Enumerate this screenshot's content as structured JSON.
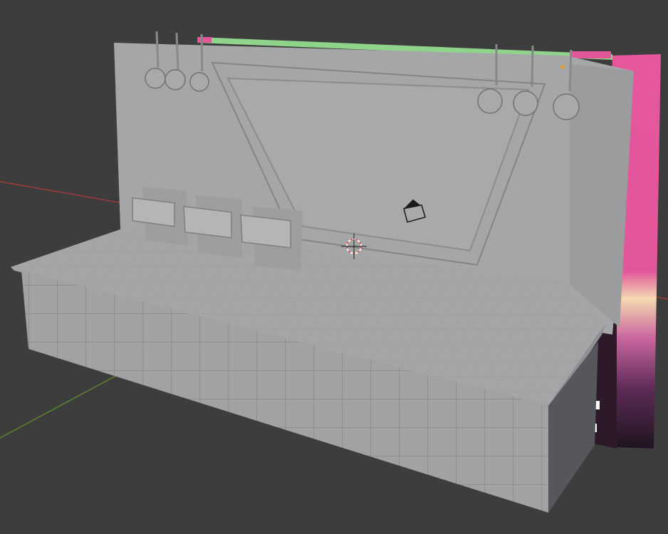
{
  "viewport": {
    "type": "3d-viewport",
    "background": "#3d3d3d",
    "grid_color": "#353535",
    "x_axis_color": "#a23c3c",
    "y_axis_color": "#5f8a2e",
    "label": ""
  },
  "scene": {
    "objects": [
      {
        "name": "stage-platform",
        "color": "#9a9c9e"
      },
      {
        "name": "back-wall",
        "color": "#a4a6a8"
      },
      {
        "name": "led-screen-strip",
        "colors": [
          "#e2569a",
          "#f08ab9",
          "#8fd48a",
          "#f4d9b1",
          "#3b1f38"
        ]
      },
      {
        "name": "pedestal",
        "count": 3
      },
      {
        "name": "spotlight",
        "count": 6
      },
      {
        "name": "camera"
      },
      {
        "name": "3d-cursor"
      }
    ]
  }
}
